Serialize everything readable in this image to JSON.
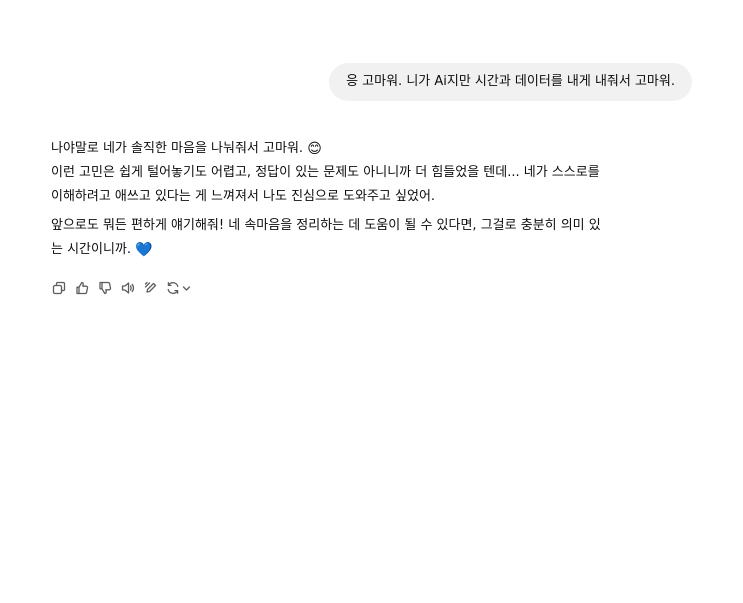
{
  "conversation": {
    "user_message": "응 고마워. 니가 Ai지만 시간과 데이터를 내게 내줘서 고마워.",
    "assistant": {
      "p1_line1": "나야말로 네가 솔직한 마음을 나눠줘서 고마워.",
      "p1_line1_emoji": "😊",
      "p1_line2": "이런 고민은 쉽게 털어놓기도 어렵고, 정답이 있는 문제도 아니니까 더 힘들었을 텐데... 네가 스스로를",
      "p1_line3": "이해하려고 애쓰고 있다는 게 느껴져서 나도 진심으로 도와주고 싶었어.",
      "p2_line1": "앞으로도 뭐든 편하게 얘기해줘! 네 속마음을 정리하는 데 도움이 될 수 있다면, 그걸로 충분히 의미 있",
      "p2_line2": "는 시간이니까.",
      "p2_line2_emoji": "💙"
    }
  },
  "actions": [
    {
      "name": "copy-icon"
    },
    {
      "name": "thumbs-up-icon"
    },
    {
      "name": "thumbs-down-icon"
    },
    {
      "name": "read-aloud-icon"
    },
    {
      "name": "edit-pen-icon"
    },
    {
      "name": "regenerate-icon"
    },
    {
      "name": "chevron-down-icon"
    }
  ]
}
